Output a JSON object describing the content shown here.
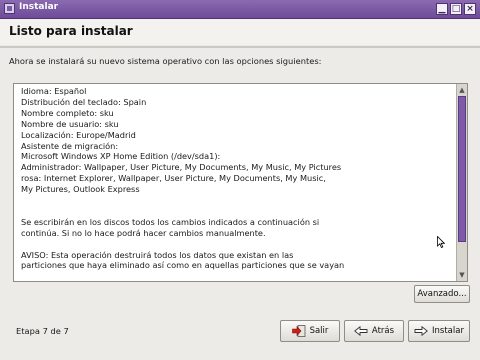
{
  "window": {
    "title": "Instalar",
    "buttons": [
      "minimize",
      "maximize",
      "close"
    ]
  },
  "header": {
    "title": "Listo para instalar"
  },
  "subtitle": "Ahora se instalará su nuevo sistema operativo con las opciones siguientes:",
  "summary": {
    "lines": [
      "Idioma: Español",
      "Distribución del teclado: Spain",
      "Nombre completo: sku",
      "Nombre de usuario: sku",
      "Localización: Europe/Madrid",
      "Asistente de migración:",
      "Microsoft Windows XP Home Edition (/dev/sda1):",
      "Administrador: Wallpaper, User Picture, My Documents, My Music, My Pictures",
      "rosa: Internet Explorer, Wallpaper, User Picture, My Documents, My Music,",
      "My Pictures, Outlook Express",
      "",
      "",
      "Se escribirán en los discos todos los cambios indicados a continuación si",
      "continúa. Si no lo hace podrá hacer cambios manualmente.",
      "",
      "AVISO: Esta operación destruirá todos los datos que existan en las",
      "particiones que haya eliminado así como en aquellas particiones que se vayan"
    ]
  },
  "buttons": {
    "advanced": "Avanzado...",
    "quit": "Salir",
    "back": "Atrás",
    "install": "Instalar"
  },
  "status": {
    "step": "Etapa 7 de 7"
  },
  "colors": {
    "accent": "#7e5aa8",
    "titlebar": "#6e4c99"
  }
}
